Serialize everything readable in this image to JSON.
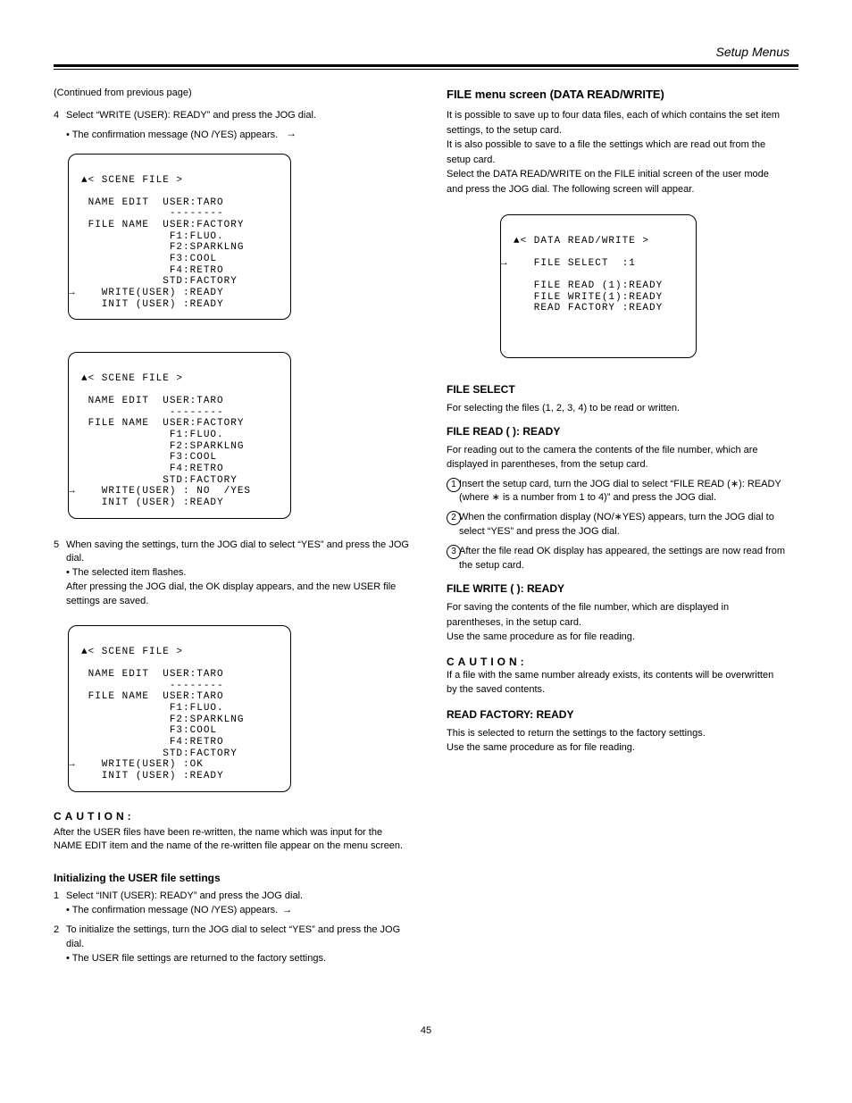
{
  "page_header": "Setup Menus",
  "page_number": "45",
  "prev_leadin": "(Continued from previous page)",
  "screen1": {
    "title": "▲< SCENE FILE >",
    "name_edit": "NAME EDIT  USER:TARO",
    "underline": "            --------",
    "file_name": "FILE NAME  USER:FACTORY",
    "f1": "             F1:FLUO.",
    "f2": "             F2:SPARKLNG",
    "f3": "             F3:COOL",
    "f4": "             F4:RETRO",
    "std": "            STD:FACTORY",
    "write": "  WRITE(USER) :READY",
    "init": "  INIT (USER) :READY",
    "arrow_note": "→"
  },
  "sect1_step4_num": "4",
  "sect1_step4": "Select “WRITE (USER): READY” and press the JOG dial.",
  "sect1_note": "• The confirmation message (NO  /YES) appears.",
  "conf_arrow": "→",
  "screen2": {
    "title": "▲< SCENE FILE >",
    "name_edit": "NAME EDIT  USER:TARO",
    "underline": "            --------",
    "file_name": "FILE NAME  USER:FACTORY",
    "f1": "             F1:FLUO.",
    "f2": "             F2:SPARKLNG",
    "f3": "             F3:COOL",
    "f4": "             F4:RETRO",
    "std": "            STD:FACTORY",
    "write": "  WRITE(USER) : NO  /YES",
    "init": "  INIT (USER) :READY",
    "arrow_note": "→"
  },
  "sect1_step5_num": "5",
  "sect1_step5a": "When saving the settings, turn the JOG dial to select “YES” and press the JOG dial.",
  "sect1_step5_note": "• The selected item flashes.",
  "sect1_step5b": "After pressing the JOG dial, the OK display appears, and the new USER file settings are saved.",
  "screen3": {
    "title": "▲< SCENE FILE >",
    "name_edit": "NAME EDIT  USER:TARO",
    "underline": "            --------",
    "file_name": "FILE NAME  USER:TARO",
    "f1": "             F1:FLUO.",
    "f2": "             F2:SPARKLNG",
    "f3": "             F3:COOL",
    "f4": "             F4:RETRO",
    "std": "            STD:FACTORY",
    "write": "  WRITE(USER) :OK",
    "init": "  INIT (USER) :READY",
    "arrow_note": "→"
  },
  "caution1": "CAUTION:",
  "caution1_body": "After the USER files have been re-written, the name which was input for the NAME EDIT item and the name of the re-written file appear on the menu screen.",
  "sect2_title": "Initializing the USER file settings",
  "sect2_step1_num": "1",
  "sect2_step1": "Select “INIT (USER): READY” and press the JOG dial.",
  "sect2_note": "• The confirmation message (NO  /YES) appears.",
  "sect2_step2_num": "2",
  "sect2_step2": "To initialize the settings, turn the JOG dial to select “YES” and press the JOG dial.",
  "sect2_note2": "• The USER file settings are returned to the factory settings.",
  "rcol_title": "FILE menu screen (DATA READ/WRITE)",
  "rcol_body1": "It is possible to save up to four data files, each of which contains the set item settings, to the setup card.",
  "rcol_body2": "It is also possible to save to a file the settings which are read out from the setup card.",
  "rcol_body3": "Select the DATA READ/WRITE on the FILE initial screen of the user mode and press the JOG dial. The following screen will appear.",
  "screen4": {
    "title": "▲< DATA READ/WRITE >",
    "file_select": "  FILE SELECT  :1",
    "file_read": "  FILE READ (1):READY",
    "file_write": "  FILE WRITE(1):READY",
    "read_factory": "  READ FACTORY :READY",
    "arrow_note": "→"
  },
  "rcol_sub1": "FILE SELECT",
  "rcol_sub1_body": "For selecting the files (1, 2, 3, 4) to be read or written.",
  "rcol_sub2": "FILE READ ( ): READY",
  "rcol_sub2_body": "For reading out to the camera the contents of the file number, which are displayed in parentheses, from the setup card.",
  "rcol_sub2_step1": "Insert the setup card, turn the JOG dial to select “FILE READ (∗): READY (where ∗ is a number from 1 to 4)” and press the JOG dial.",
  "rcol_sub2_step2": "When the confirmation display (NO/∗YES) appears, turn the JOG dial to select “YES” and press the JOG dial.",
  "rcol_sub2_step3": "After the file read OK display has appeared, the settings are now read from the setup card.",
  "rcol_sub3": "FILE WRITE ( ): READY",
  "rcol_sub3_body": "For saving the contents of the file number, which are displayed in parentheses, in the setup card.",
  "rcol_sub3_body2": "Use the same procedure as for file reading.",
  "caution2": "CAUTION:",
  "caution2_body": "If a file with the same number already exists, its contents will be overwritten by the saved contents.",
  "rcol_sub4": "READ FACTORY: READY",
  "rcol_sub4_body": "This is selected to return the settings to the factory settings.",
  "rcol_sub4_body2": "Use the same procedure as for file reading."
}
